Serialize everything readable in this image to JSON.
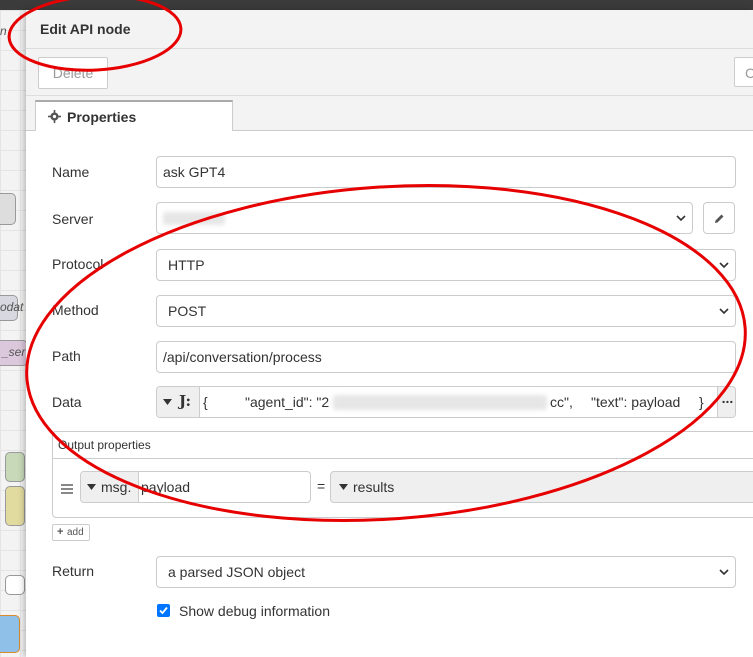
{
  "background": {
    "canvas_texts": [
      "n",
      "odat",
      "_ser"
    ]
  },
  "dialog": {
    "title": "Edit API node",
    "delete_label": "Delete",
    "right_button_label": "C"
  },
  "tabs": [
    {
      "label": "Properties",
      "icon": "gear-icon"
    }
  ],
  "form": {
    "name": {
      "label": "Name",
      "value": "ask GPT4"
    },
    "server": {
      "label": "Server",
      "value": ""
    },
    "protocol": {
      "label": "Protocol",
      "value": "HTTP"
    },
    "method": {
      "label": "Method",
      "value": "POST"
    },
    "path": {
      "label": "Path",
      "value": "/api/conversation/process"
    },
    "data": {
      "label": "Data",
      "brace_open": "{",
      "agent_key": "\"agent_id\": \"2",
      "agent_tail": "cc\",",
      "text_pair": "\"text\": payload",
      "brace_close": "}",
      "more": "..."
    },
    "output": {
      "title": "Output properties",
      "prefix": "msg.",
      "property": "payload",
      "equals": "=",
      "value": "results",
      "add_label": "add"
    },
    "return": {
      "label": "Return",
      "value": "a parsed JSON object"
    },
    "debug": {
      "label": "Show debug information",
      "checked": true
    }
  },
  "colors": {
    "annotation": "#e60000",
    "checkbox": "#0075ff",
    "header_bg": "#f3f3f3"
  }
}
